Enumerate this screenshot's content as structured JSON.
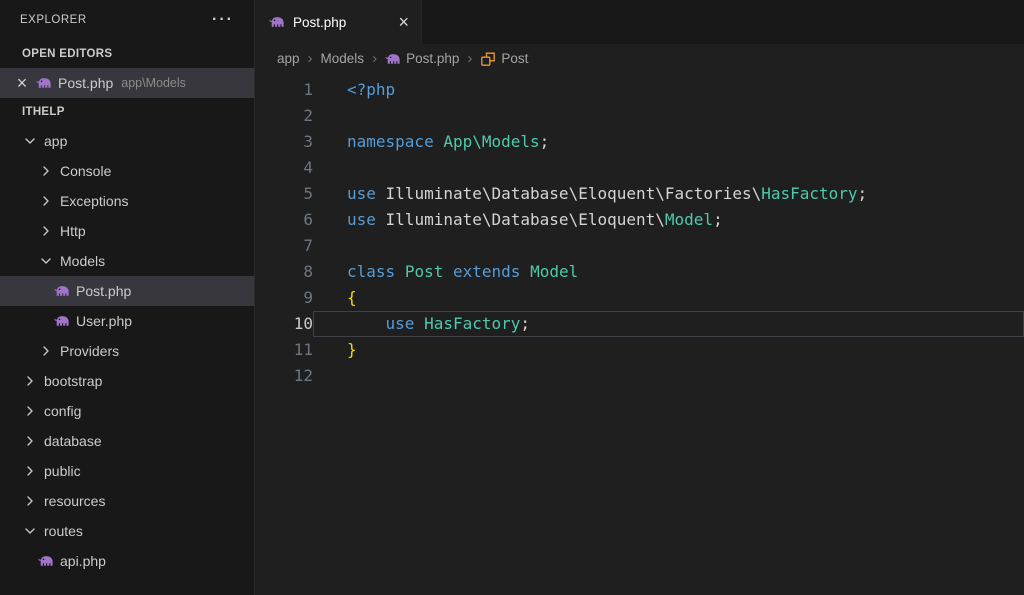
{
  "colors": {
    "keyword": "#569cd6",
    "type": "#4ec9b0",
    "text": "#d4d4d4",
    "brace": "#ffd700",
    "php_icon": "#a074c9",
    "class_icon": "#ee9d28"
  },
  "explorer": {
    "title": "EXPLORER",
    "more_actions": "···",
    "open_editors": {
      "label": "OPEN EDITORS",
      "items": [
        {
          "close": "×",
          "file": "Post.php",
          "detail": "app\\Models",
          "icon": "php",
          "selected": true
        }
      ]
    },
    "project": {
      "label": "ITHELP",
      "tree": [
        {
          "label": "app",
          "kind": "folder",
          "expanded": true,
          "depth": 1
        },
        {
          "label": "Console",
          "kind": "folder",
          "expanded": false,
          "depth": 2
        },
        {
          "label": "Exceptions",
          "kind": "folder",
          "expanded": false,
          "depth": 2
        },
        {
          "label": "Http",
          "kind": "folder",
          "expanded": false,
          "depth": 2
        },
        {
          "label": "Models",
          "kind": "folder",
          "expanded": true,
          "depth": 2
        },
        {
          "label": "Post.php",
          "kind": "php-file",
          "depth": 3,
          "selected": true
        },
        {
          "label": "User.php",
          "kind": "php-file",
          "depth": 3
        },
        {
          "label": "Providers",
          "kind": "folder",
          "expanded": false,
          "depth": 2
        },
        {
          "label": "bootstrap",
          "kind": "folder",
          "expanded": false,
          "depth": 1
        },
        {
          "label": "config",
          "kind": "folder",
          "expanded": false,
          "depth": 1
        },
        {
          "label": "database",
          "kind": "folder",
          "expanded": false,
          "depth": 1
        },
        {
          "label": "public",
          "kind": "folder",
          "expanded": false,
          "depth": 1
        },
        {
          "label": "resources",
          "kind": "folder",
          "expanded": false,
          "depth": 1
        },
        {
          "label": "routes",
          "kind": "folder",
          "expanded": true,
          "depth": 1
        },
        {
          "label": "api.php",
          "kind": "php-file",
          "depth": 2
        }
      ]
    }
  },
  "editor": {
    "tab": {
      "label": "Post.php",
      "close": "×",
      "icon": "php"
    },
    "breadcrumb": [
      {
        "label": "app"
      },
      {
        "label": "Models"
      },
      {
        "label": "Post.php",
        "icon": "php"
      },
      {
        "label": "Post",
        "icon": "class"
      }
    ],
    "active_line": 10,
    "code": [
      {
        "n": 1,
        "tokens": [
          {
            "t": "<?php",
            "c": "keyword"
          }
        ]
      },
      {
        "n": 2,
        "tokens": []
      },
      {
        "n": 3,
        "tokens": [
          {
            "t": "namespace",
            "c": "keyword"
          },
          {
            "t": " ",
            "c": "text"
          },
          {
            "t": "App\\Models",
            "c": "type"
          },
          {
            "t": ";",
            "c": "text"
          }
        ]
      },
      {
        "n": 4,
        "tokens": []
      },
      {
        "n": 5,
        "tokens": [
          {
            "t": "use",
            "c": "keyword"
          },
          {
            "t": " Illuminate\\Database\\Eloquent\\Factories\\",
            "c": "text"
          },
          {
            "t": "HasFactory",
            "c": "type"
          },
          {
            "t": ";",
            "c": "text"
          }
        ]
      },
      {
        "n": 6,
        "tokens": [
          {
            "t": "use",
            "c": "keyword"
          },
          {
            "t": " Illuminate\\Database\\Eloquent\\",
            "c": "text"
          },
          {
            "t": "Model",
            "c": "type"
          },
          {
            "t": ";",
            "c": "text"
          }
        ]
      },
      {
        "n": 7,
        "tokens": []
      },
      {
        "n": 8,
        "tokens": [
          {
            "t": "class",
            "c": "keyword"
          },
          {
            "t": " ",
            "c": "text"
          },
          {
            "t": "Post",
            "c": "type"
          },
          {
            "t": " ",
            "c": "text"
          },
          {
            "t": "extends",
            "c": "keyword"
          },
          {
            "t": " ",
            "c": "text"
          },
          {
            "t": "Model",
            "c": "type"
          }
        ]
      },
      {
        "n": 9,
        "tokens": [
          {
            "t": "{",
            "c": "brace"
          }
        ]
      },
      {
        "n": 10,
        "tokens": [
          {
            "t": "    ",
            "c": "text"
          },
          {
            "t": "use",
            "c": "keyword"
          },
          {
            "t": " ",
            "c": "text"
          },
          {
            "t": "HasFactory",
            "c": "type"
          },
          {
            "t": ";",
            "c": "text"
          }
        ]
      },
      {
        "n": 11,
        "tokens": [
          {
            "t": "}",
            "c": "brace"
          }
        ]
      },
      {
        "n": 12,
        "tokens": []
      }
    ]
  }
}
